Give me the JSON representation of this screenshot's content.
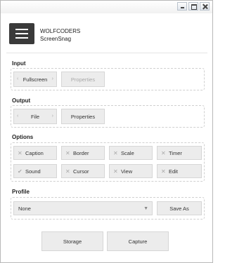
{
  "app": {
    "brand_line1": "WOLFCODERS",
    "brand_line2": "ScreenSnag"
  },
  "input": {
    "label": "Input",
    "source": "Fullscreen",
    "properties": "Properties"
  },
  "output": {
    "label": "Output",
    "target": "File",
    "properties": "Properties"
  },
  "options": {
    "label": "Options",
    "items": [
      {
        "label": "Caption",
        "mark": "✕"
      },
      {
        "label": "Border",
        "mark": "✕"
      },
      {
        "label": "Scale",
        "mark": "✕"
      },
      {
        "label": "Timer",
        "mark": "✕"
      },
      {
        "label": "Sound",
        "mark": "✔"
      },
      {
        "label": "Cursor",
        "mark": "✕"
      },
      {
        "label": "View",
        "mark": "✕"
      },
      {
        "label": "Edit",
        "mark": "✕"
      }
    ]
  },
  "profile": {
    "label": "Profile",
    "selected": "None",
    "save_as": "Save As"
  },
  "actions": {
    "storage": "Storage",
    "capture": "Capture"
  },
  "colors": {
    "button_bg": "#ececec",
    "logo_bg": "#3a3a3a",
    "disabled_text": "#a8a8a8"
  },
  "icons": {
    "logo": "hamburger-menu-icon",
    "window_min": "minimize-icon",
    "window_max": "maximize-icon",
    "window_close": "close-icon"
  }
}
